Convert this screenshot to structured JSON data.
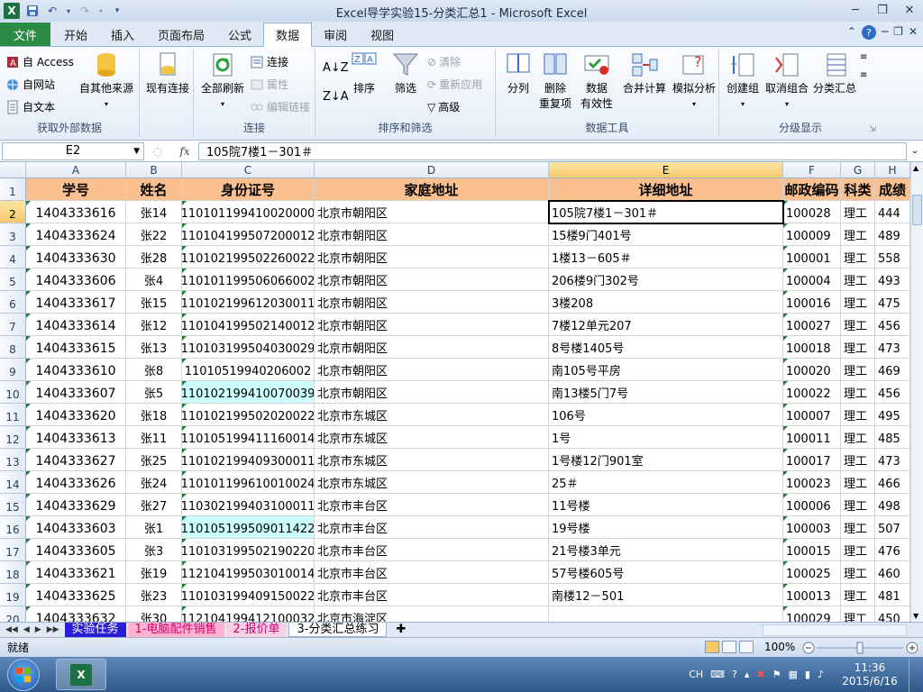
{
  "window": {
    "title": "Excel导学实验15-分类汇总1 - Microsoft Excel"
  },
  "ribbon_tabs": [
    "文件",
    "开始",
    "插入",
    "页面布局",
    "公式",
    "数据",
    "审阅",
    "视图"
  ],
  "active_tab": "数据",
  "ribbon": {
    "get_external": {
      "access": "自 Access",
      "web": "自网站",
      "text": "自文本",
      "other": "自其他来源",
      "label": "获取外部数据"
    },
    "existing": "现有连接",
    "connections": {
      "refresh": "全部刷新",
      "connect": "连接",
      "props": "属性",
      "edit_links": "编辑链接",
      "label": "连接"
    },
    "sort": {
      "sort": "排序",
      "filter": "筛选",
      "clear": "清除",
      "reapply": "重新应用",
      "advanced": "高级",
      "label": "排序和筛选"
    },
    "tools": {
      "split": "分列",
      "remove_dup": "删除\n重复项",
      "validation": "数据\n有效性",
      "consolidate": "合并计算",
      "whatif": "模拟分析",
      "label": "数据工具"
    },
    "outline": {
      "group": "创建组",
      "ungroup": "取消组合",
      "subtotal": "分类汇总",
      "label": "分级显示"
    }
  },
  "formula_bar": {
    "name_box": "E2",
    "fx": "fx",
    "content": "105院7楼1－301＃"
  },
  "columns": [
    "A",
    "B",
    "C",
    "D",
    "E",
    "F",
    "G",
    "H"
  ],
  "headers": [
    "学号",
    "姓名",
    "身份证号",
    "家庭地址",
    "详细地址",
    "邮政编码",
    "科类",
    "成绩"
  ],
  "rows": [
    {
      "n": "1",
      "v": [
        "学号",
        "姓名",
        "身份证号",
        "家庭地址",
        "详细地址",
        "邮政编码",
        "科类",
        "成绩"
      ]
    },
    {
      "n": "2",
      "v": [
        "1404333616",
        "张14",
        "110101199410020000",
        "北京市朝阳区",
        "105院7楼1－301＃",
        "100028",
        "理工",
        "444"
      ]
    },
    {
      "n": "3",
      "v": [
        "1404333624",
        "张22",
        "110104199507200012",
        "北京市朝阳区",
        "15楼9门401号",
        "100009",
        "理工",
        "489"
      ]
    },
    {
      "n": "4",
      "v": [
        "1404333630",
        "张28",
        "110102199502260022",
        "北京市朝阳区",
        "1楼13－605＃",
        "100001",
        "理工",
        "558"
      ]
    },
    {
      "n": "5",
      "v": [
        "1404333606",
        "张4",
        "110101199506066002",
        "北京市朝阳区",
        "206楼9门302号",
        "100004",
        "理工",
        "493"
      ]
    },
    {
      "n": "6",
      "v": [
        "1404333617",
        "张15",
        "110102199612030011",
        "北京市朝阳区",
        "3楼208",
        "100016",
        "理工",
        "475"
      ]
    },
    {
      "n": "7",
      "v": [
        "1404333614",
        "张12",
        "110104199502140012",
        "北京市朝阳区",
        "7楼12单元207",
        "100027",
        "理工",
        "456"
      ]
    },
    {
      "n": "8",
      "v": [
        "1404333615",
        "张13",
        "110103199504030029",
        "北京市朝阳区",
        "8号楼1405号",
        "100018",
        "理工",
        "473"
      ]
    },
    {
      "n": "9",
      "v": [
        "1404333610",
        "张8",
        "11010519940206002",
        "北京市朝阳区",
        "南105号平房",
        "100020",
        "理工",
        "469"
      ]
    },
    {
      "n": "10",
      "v": [
        "1404333607",
        "张5",
        "110102199410070039",
        "北京市朝阳区",
        "南13楼5门7号",
        "100022",
        "理工",
        "456"
      ]
    },
    {
      "n": "11",
      "v": [
        "1404333620",
        "张18",
        "110102199502020022",
        "北京市东城区",
        "106号",
        "100007",
        "理工",
        "495"
      ]
    },
    {
      "n": "12",
      "v": [
        "1404333613",
        "张11",
        "110105199411160014",
        "北京市东城区",
        "1号",
        "100011",
        "理工",
        "485"
      ]
    },
    {
      "n": "13",
      "v": [
        "1404333627",
        "张25",
        "110102199409300011",
        "北京市东城区",
        "1号楼12门901室",
        "100017",
        "理工",
        "473"
      ]
    },
    {
      "n": "14",
      "v": [
        "1404333626",
        "张24",
        "110101199610010024",
        "北京市东城区",
        "25＃",
        "100023",
        "理工",
        "466"
      ]
    },
    {
      "n": "15",
      "v": [
        "1404333629",
        "张27",
        "110302199403100011",
        "北京市丰台区",
        "11号楼",
        "100006",
        "理工",
        "498"
      ]
    },
    {
      "n": "16",
      "v": [
        "1404333603",
        "张1",
        "110105199509011422",
        "北京市丰台区",
        "19号楼",
        "100003",
        "理工",
        "507"
      ]
    },
    {
      "n": "17",
      "v": [
        "1404333605",
        "张3",
        "110103199502190220",
        "北京市丰台区",
        "21号楼3单元",
        "100015",
        "理工",
        "476"
      ]
    },
    {
      "n": "18",
      "v": [
        "1404333621",
        "张19",
        "112104199503010014",
        "北京市丰台区",
        "57号楼605号",
        "100025",
        "理工",
        "460"
      ]
    },
    {
      "n": "19",
      "v": [
        "1404333625",
        "张23",
        "110103199409150022",
        "北京市丰台区",
        "南楼12－501",
        "100013",
        "理工",
        "481"
      ]
    },
    {
      "n": "20",
      "v": [
        "1404333632",
        "张30",
        "112104199412100032",
        "北京市海淀区",
        "",
        "100029",
        "理工",
        "450"
      ]
    }
  ],
  "sheet_tabs": [
    "实验任务",
    "1-电脑配件销售",
    "2-报价单",
    "3-分类汇总练习"
  ],
  "status": {
    "ready": "就绪",
    "zoom": "100%"
  },
  "taskbar": {
    "ime": "CH",
    "time": "11:36",
    "date": "2015/6/16"
  },
  "colors": {
    "header_fill": "#fac090",
    "cyan_fill": "#ccffff",
    "file_tab": "#2a8c45"
  }
}
